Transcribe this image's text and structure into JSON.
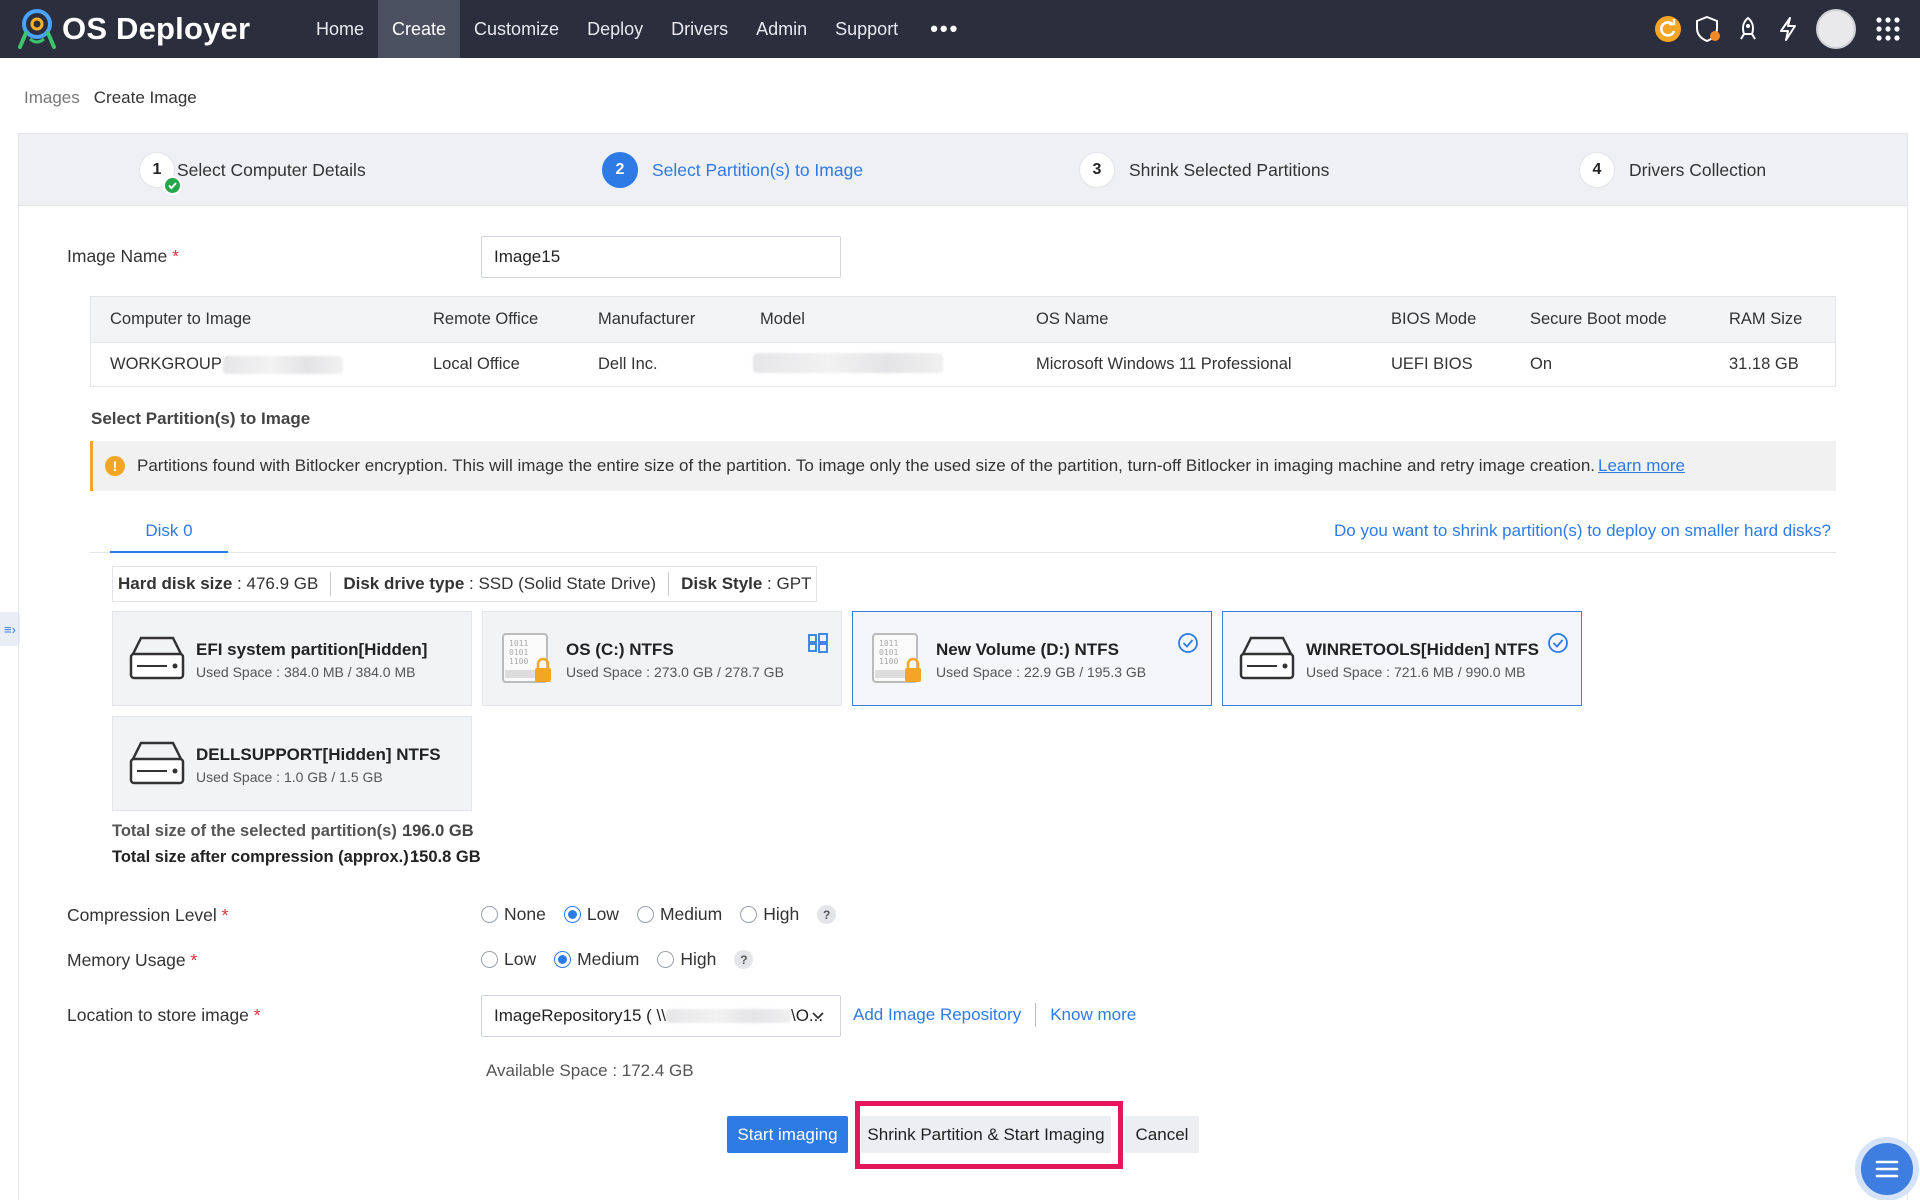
{
  "app": {
    "title": "OS Deployer"
  },
  "nav": [
    "Home",
    "Create",
    "Customize",
    "Deploy",
    "Drivers",
    "Admin",
    "Support"
  ],
  "nav_more": "•••",
  "breadcrumb": {
    "parent": "Images",
    "current": "Create Image"
  },
  "steps": [
    {
      "num": "1",
      "label": "Select Computer Details",
      "state": "done"
    },
    {
      "num": "2",
      "label": "Select Partition(s) to Image",
      "state": "active"
    },
    {
      "num": "3",
      "label": "Shrink Selected Partitions",
      "state": "pending"
    },
    {
      "num": "4",
      "label": "Drivers Collection",
      "state": "pending"
    }
  ],
  "image_name": {
    "label": "Image Name",
    "required": "*",
    "value": "Image15"
  },
  "computer_table": {
    "headers": [
      "Computer to Image",
      "Remote Office",
      "Manufacturer",
      "Model",
      "OS Name",
      "BIOS Mode",
      "Secure Boot mode",
      "RAM Size"
    ],
    "row": [
      "WORKGROUP \\",
      "Local Office",
      "Dell Inc.",
      "",
      "Microsoft Windows 11 Professional",
      "UEFI BIOS",
      "On",
      "31.18 GB"
    ]
  },
  "partition_section": {
    "title": "Select Partition(s) to Image"
  },
  "alert": {
    "icon": "exclamation-icon",
    "text": "Partitions found with Bitlocker encryption. This will image the entire size of the partition. To image only the used size of the partition, turn-off Bitlocker in imaging machine and retry image creation.",
    "link": "Learn more"
  },
  "disk_tab": {
    "label": "Disk 0",
    "shrink_question": "Do you want to shrink partition(s) to deploy on smaller hard disks?"
  },
  "disk_info": {
    "size_label": "Hard disk size",
    "size_value": " : 476.9 GB",
    "type_label": "Disk drive type",
    "type_value": " : SSD (Solid State Drive)",
    "style_label": "Disk Style",
    "style_value": " : GPT"
  },
  "partitions": [
    {
      "name": "EFI system partition[Hidden]",
      "used": "Used Space : 384.0 MB / 384.0 MB",
      "icon": "hard-drive-icon",
      "selected": false
    },
    {
      "name": "OS (C:) NTFS",
      "used": "Used Space : 273.0 GB / 278.7 GB",
      "icon": "encrypted-drive-icon",
      "badge": "windows-icon",
      "selected": false
    },
    {
      "name": "New Volume (D:) NTFS",
      "used": "Used Space : 22.9 GB / 195.3 GB",
      "icon": "encrypted-drive-icon",
      "badge": "check-circle-icon",
      "selected": true
    },
    {
      "name": "WINRETOOLS[Hidden] NTFS",
      "used": "Used Space : 721.6 MB / 990.0 MB",
      "icon": "hard-drive-icon",
      "badge": "check-circle-icon",
      "selected": true
    },
    {
      "name": "DELLSUPPORT[Hidden] NTFS",
      "used": "Used Space : 1.0 GB / 1.5 GB",
      "icon": "hard-drive-icon",
      "selected": false
    }
  ],
  "totals": {
    "selected_label": "Total size of the selected partition(s) :",
    "selected_value": "196.0 GB",
    "compressed_label": "Total size after compression (approx.) :",
    "compressed_value": "150.8 GB"
  },
  "compression": {
    "label": "Compression Level",
    "required": "*",
    "options": [
      "None",
      "Low",
      "Medium",
      "High"
    ],
    "selected": "Low",
    "help": "?"
  },
  "memory": {
    "label": "Memory Usage",
    "required": "*",
    "options": [
      "Low",
      "Medium",
      "High"
    ],
    "selected": "Medium",
    "help": "?"
  },
  "location": {
    "label": "Location to store image",
    "required": "*",
    "value_prefix": "ImageRepository15 ( \\\\",
    "value_suffix": "\\O...",
    "add_link": "Add Image Repository",
    "know_link": "Know more",
    "available": "Available Space : 172.4 GB"
  },
  "buttons": {
    "start": "Start imaging",
    "shrink_start": "Shrink Partition & Start Imaging",
    "cancel": "Cancel"
  },
  "colors": {
    "topbar": "#2a2e3d",
    "accent": "#2e7be6",
    "highlight": "#e5175b",
    "success": "#26a64a",
    "warning": "#f5a524"
  }
}
